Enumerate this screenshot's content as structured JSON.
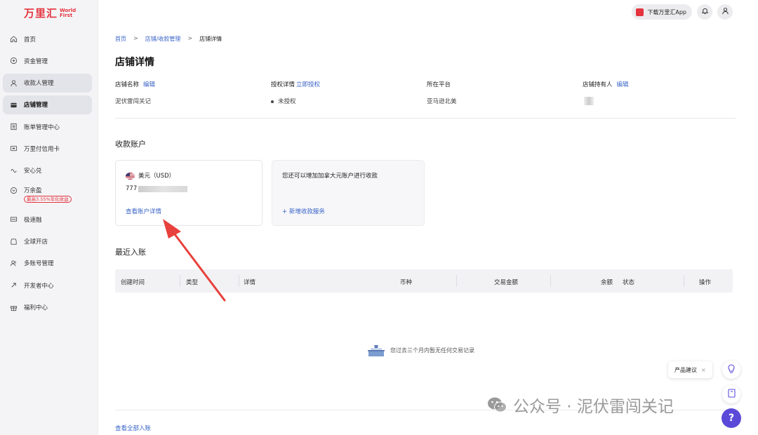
{
  "brand": {
    "name_cn": "万里汇",
    "name_en_line1": "World",
    "name_en_line2": "First",
    "color": "#e5343f"
  },
  "sidebar": {
    "items": [
      {
        "label": "首页",
        "icon": "home-icon"
      },
      {
        "label": "资金管理",
        "icon": "funds-icon"
      },
      {
        "label": "收款人管理",
        "icon": "payee-icon"
      },
      {
        "label": "店铺管理",
        "icon": "store-icon"
      },
      {
        "label": "账单管理中心",
        "icon": "bill-icon"
      },
      {
        "label": "万里付信用卡",
        "icon": "card-icon"
      },
      {
        "label": "安心兑",
        "icon": "exchange-icon"
      },
      {
        "label": "万余盈",
        "icon": "savings-icon",
        "badge": "最高3.55%年化收益"
      },
      {
        "label": "极速融",
        "icon": "finance-icon"
      },
      {
        "label": "全球开店",
        "icon": "global-store-icon"
      },
      {
        "label": "多账号管理",
        "icon": "multi-account-icon"
      },
      {
        "label": "开发者中心",
        "icon": "developer-icon"
      },
      {
        "label": "福利中心",
        "icon": "gift-icon"
      }
    ]
  },
  "topbar": {
    "app_label": "下载万里汇App"
  },
  "breadcrumb": {
    "home": "首页",
    "parent": "店铺/收款管理",
    "current": "店铺详情",
    "sep": ">"
  },
  "page_title": "店铺详情",
  "store_info": {
    "name_label": "店铺名称",
    "name_edit": "编辑",
    "name_value": "泥伏雷闯关记",
    "auth_label": "授权详情",
    "auth_action": "立即授权",
    "auth_value": "未授权",
    "platform_label": "所在平台",
    "platform_value": "亚马逊北美",
    "owner_label": "店铺持有人",
    "owner_edit": "编辑"
  },
  "accounts": {
    "title": "收款账户",
    "usd_card": {
      "currency": "美元（USD）",
      "account_prefix": "777",
      "link": "查看账户详情"
    },
    "add_card": {
      "text": "您还可以增加加拿大元账户进行收款",
      "add_link": "+ 新增收款服务"
    }
  },
  "recent": {
    "title": "最近入账",
    "columns": [
      "创建时间",
      "类型",
      "详情",
      "币种",
      "交易金额",
      "余额",
      "状态",
      "操作"
    ],
    "empty_text": "您过去三个月内暂无任何交易记录",
    "view_all": "查看全部入账"
  },
  "floating": {
    "feedback_label": "产品建议",
    "close": "×",
    "help": "?"
  },
  "watermark": {
    "text": "公众号 · 泥伏雷闯关记"
  },
  "annotation_arrow_color": "#e8403c"
}
